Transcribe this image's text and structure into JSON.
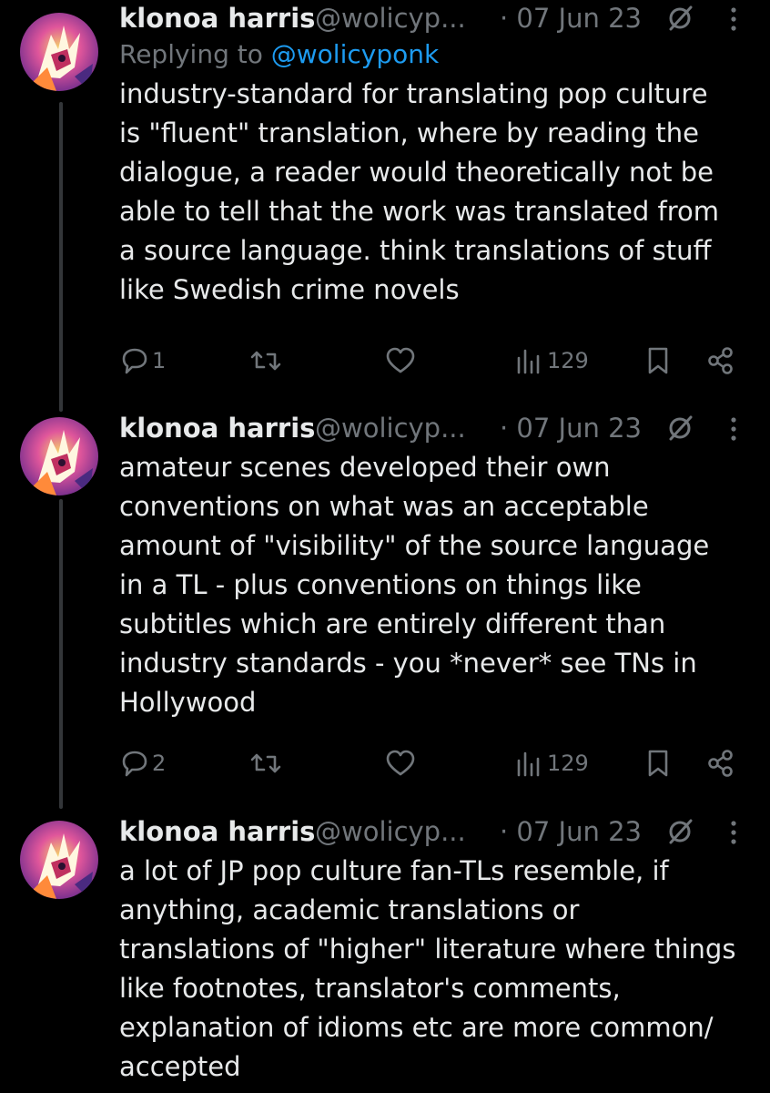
{
  "tweets": [
    {
      "author_name": "klonoa harris",
      "author_handle": "@wolicyp...",
      "date": "· 07 Jun 23",
      "replying_prefix": "Replying to ",
      "replying_to": "@wolicyponk",
      "text": "industry-standard for translating pop culture\nis \"fluent\" translation, where by reading the\ndialogue, a reader would theoretically not be\nable to tell that the work was translated from\na source language. think translations of stuff\nlike Swedish crime novels",
      "reply_count": "1",
      "retweet_count": "",
      "like_count": "",
      "view_count": "129"
    },
    {
      "author_name": "klonoa harris",
      "author_handle": "@wolicyp...",
      "date": "· 07 Jun 23",
      "text": "amateur scenes developed their own\nconventions on what was an acceptable\namount of \"visibility\" of the source language\nin a TL - plus conventions on things like\nsubtitles which are entirely different than\nindustry standards - you *never* see TNs in\nHollywood",
      "reply_count": "2",
      "retweet_count": "",
      "like_count": "",
      "view_count": "129"
    },
    {
      "author_name": "klonoa harris",
      "author_handle": "@wolicyp...",
      "date": "· 07 Jun 23",
      "text": "a lot of JP pop culture fan-TLs resemble, if\nanything, academic translations or\ntranslations of \"higher\" literature where things\nlike footnotes, translator's comments,\nexplanation of idioms etc are more common/\naccepted"
    }
  ],
  "icons": {
    "reply": "reply-icon",
    "retweet": "retweet-icon",
    "like": "heart-icon",
    "views": "views-icon",
    "bookmark": "bookmark-icon",
    "share": "share-icon",
    "grok": "grok-icon",
    "more": "more-vertical-icon"
  },
  "colors": {
    "background": "#000000",
    "text": "#e7e9ea",
    "secondary": "#71767b",
    "link": "#1d9bf0",
    "thread_line": "#333639"
  }
}
